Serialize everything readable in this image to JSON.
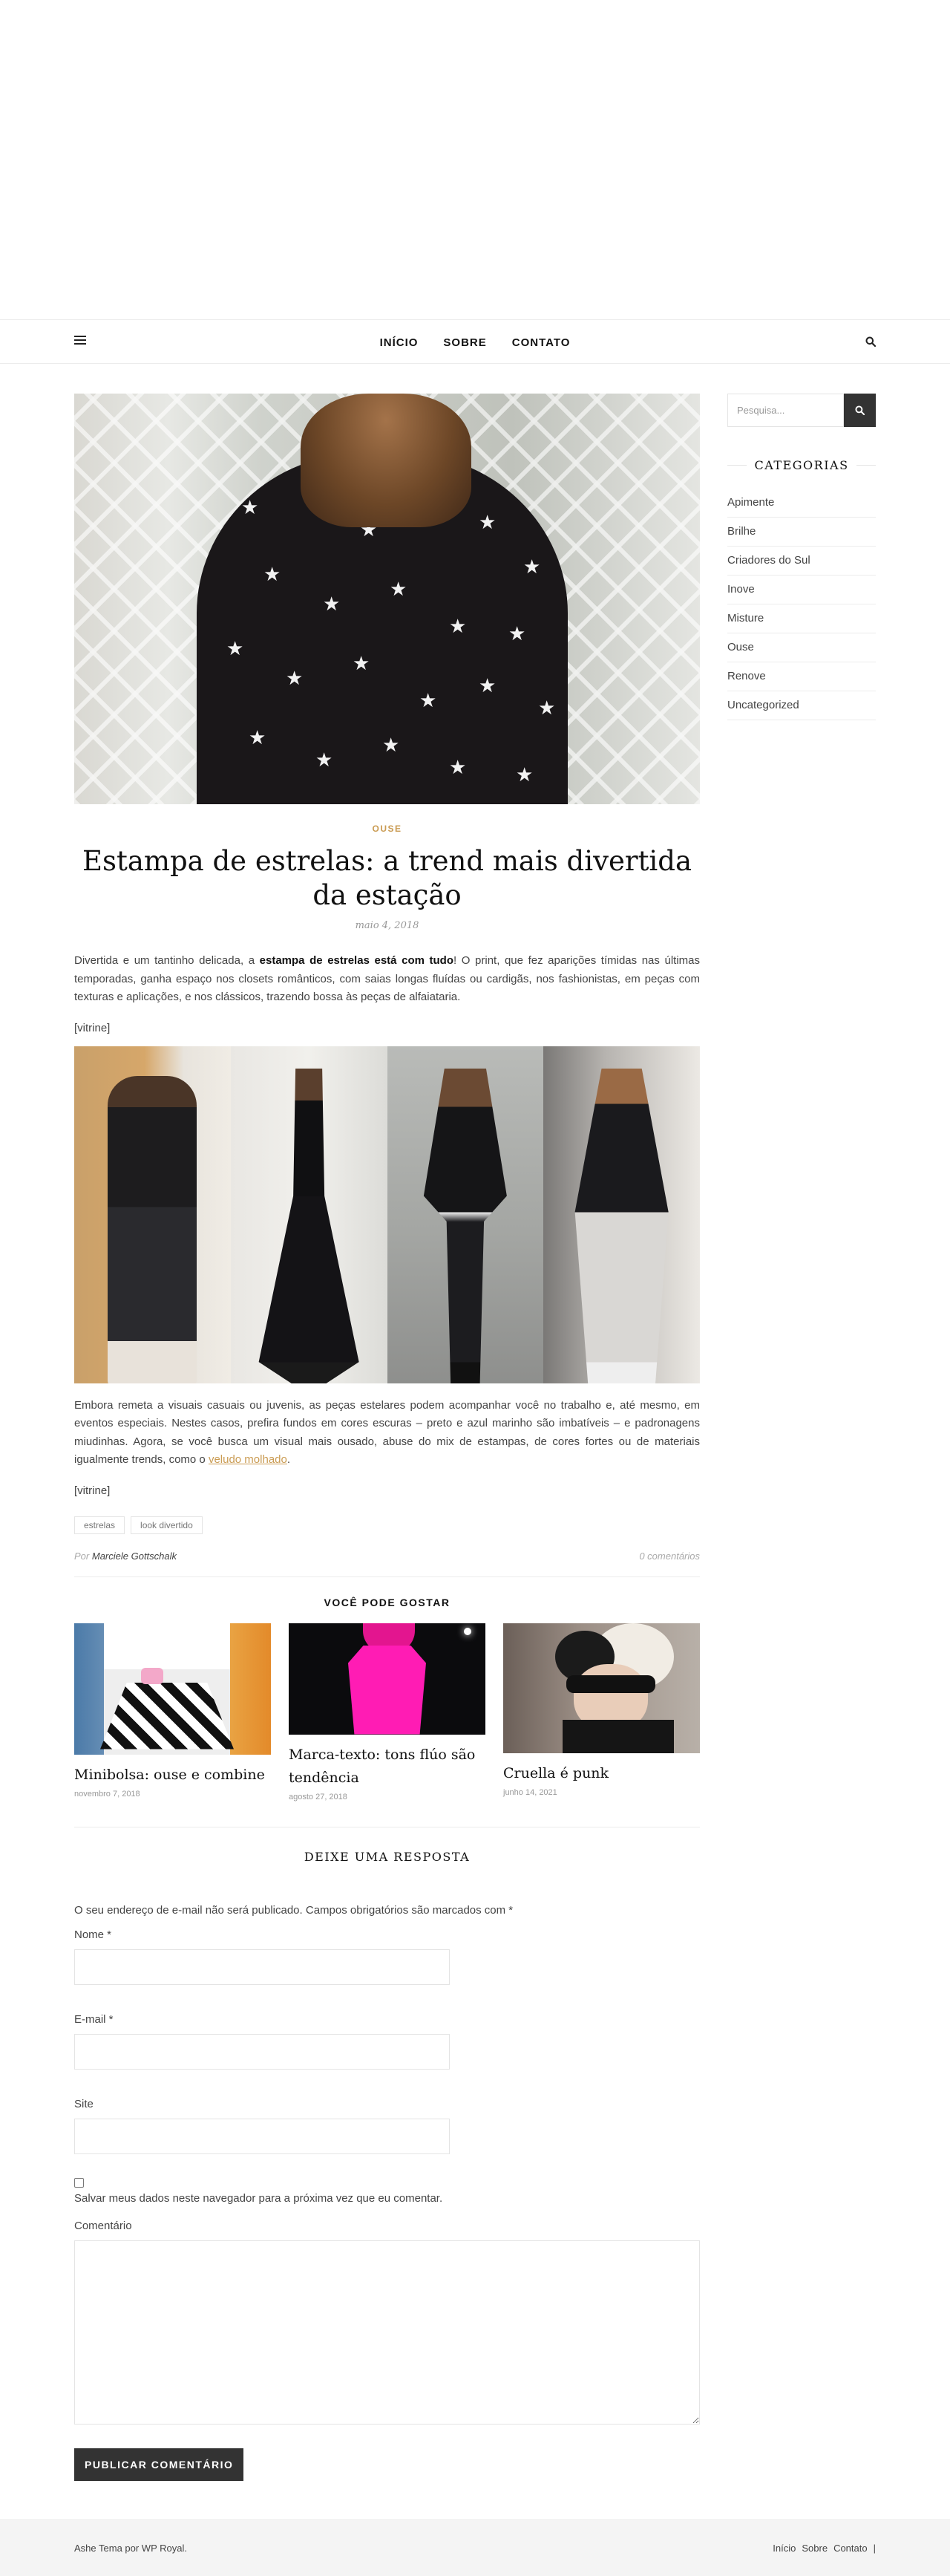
{
  "nav": {
    "links": [
      "INÍCIO",
      "SOBRE",
      "CONTATO"
    ]
  },
  "post": {
    "category": "OUSE",
    "title": "Estampa de estrelas: a trend mais divertida da estação",
    "date": "maio 4, 2018",
    "para1_a": "Divertida e um tantinho delicada, a ",
    "para1_bold": "estampa de estrelas está com tudo",
    "para1_b": "! O print, que fez aparições tímidas nas últimas temporadas, ganha espaço nos closets românticos, com saias longas fluídas ou cardigãs, nos fashionistas, em peças com texturas e aplicações, e nos clássicos, trazendo bossa às peças de alfaiataria.",
    "shortcode1": "[vitrine]",
    "para2_a": "Embora remeta a visuais casuais ou juvenis, as peças estelares podem acompanhar você no trabalho e, até mesmo, em eventos especiais. Nestes casos, prefira fundos em cores escuras – preto e azul marinho são imbatíveis – e padronagens miudinhas. Agora, se você busca um visual mais ousado, abuse do mix de estampas, de cores fortes ou de materiais igualmente trends, como o ",
    "para2_link": "veludo molhado",
    "para2_b": ".",
    "shortcode2": "[vitrine]",
    "tags": [
      "estrelas",
      "look divertido"
    ],
    "author_prefix": "Por",
    "author": "Marciele Gottschalk",
    "comments": "0 comentários"
  },
  "related": {
    "title": "VOCÊ PODE GOSTAR",
    "items": [
      {
        "name": "Minibolsa: ouse e combine",
        "date": "novembro 7, 2018"
      },
      {
        "name": "Marca-texto: tons flúo são tendência",
        "date": "agosto 27, 2018"
      },
      {
        "name": "Cruella é punk",
        "date": "junho 14, 2021"
      }
    ]
  },
  "reply": {
    "title": "DEIXE UMA RESPOSTA",
    "notes": "O seu endereço de e-mail não será publicado. Campos obrigatórios são marcados com *",
    "name_label": "Nome *",
    "email_label": "E-mail *",
    "site_label": "Site",
    "cookie_label": "Salvar meus dados neste navegador para a próxima vez que eu comentar.",
    "comment_label": "Comentário",
    "submit_label": "PUBLICAR COMENTÁRIO"
  },
  "sidebar": {
    "search_placeholder": "Pesquisa...",
    "categories_title": "CATEGORIAS",
    "categories": [
      "Apimente",
      "Brilhe",
      "Criadores do Sul",
      "Inove",
      "Misture",
      "Ouse",
      "Renove",
      "Uncategorized"
    ]
  },
  "footer": {
    "credit": "Ashe Tema por WP Royal.",
    "links": [
      "Início",
      "Sobre",
      "Contato",
      "|"
    ]
  },
  "colors": {
    "accent": "#ca9b52",
    "dark": "#333333"
  },
  "icons": [
    "menu-icon",
    "search-icon"
  ]
}
